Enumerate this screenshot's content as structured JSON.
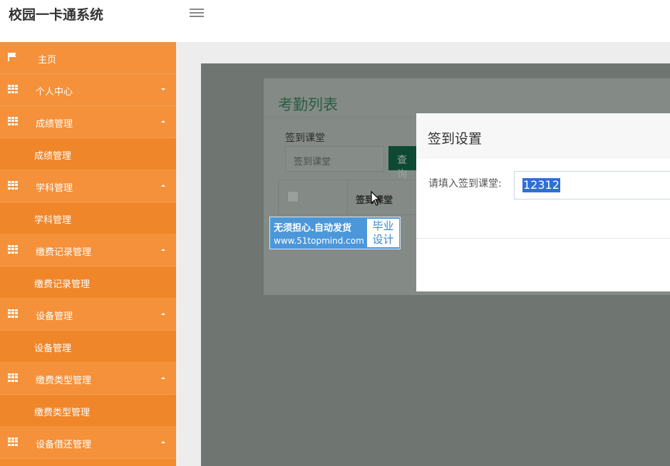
{
  "header": {
    "app_title": "校园一卡通系统"
  },
  "sidebar": {
    "items": [
      {
        "label": "主页",
        "icon": "flag-icon",
        "type": "home"
      },
      {
        "label": "个人中心",
        "icon": "grid-icon",
        "type": "parent",
        "caret": "down"
      },
      {
        "label": "成绩管理",
        "icon": "grid-icon",
        "type": "parent",
        "caret": "up"
      },
      {
        "label": "成绩管理",
        "type": "child"
      },
      {
        "label": "学科管理",
        "icon": "grid-icon",
        "type": "parent",
        "caret": "up"
      },
      {
        "label": "学科管理",
        "type": "child"
      },
      {
        "label": "缴费记录管理",
        "icon": "grid-icon",
        "type": "parent",
        "caret": "up"
      },
      {
        "label": "缴费记录管理",
        "type": "child"
      },
      {
        "label": "设备管理",
        "icon": "grid-icon",
        "type": "parent",
        "caret": "up"
      },
      {
        "label": "设备管理",
        "type": "child"
      },
      {
        "label": "缴费类型管理",
        "icon": "grid-icon",
        "type": "parent",
        "caret": "up"
      },
      {
        "label": "缴费类型管理",
        "type": "child"
      },
      {
        "label": "设备借还管理",
        "icon": "grid-icon",
        "type": "parent",
        "caret": "up"
      }
    ]
  },
  "panel": {
    "title": "考勤列表",
    "search_label": "签到课堂",
    "search_placeholder": "签到课堂",
    "query_button": "查询",
    "column_header": "签到课堂"
  },
  "banner": {
    "line1": "无须担心.自动发货",
    "line2": "www.51topmind.com",
    "right_line1": "毕业",
    "right_line2": "设计"
  },
  "modal": {
    "title": "签到设置",
    "label": "请填入签到课堂:",
    "input_value": "12312"
  },
  "colors": {
    "sidebar": "#f28a2f",
    "accent_green": "#0e4a33",
    "banner_blue": "#4b97da",
    "selection_blue": "#2f6fd3"
  }
}
